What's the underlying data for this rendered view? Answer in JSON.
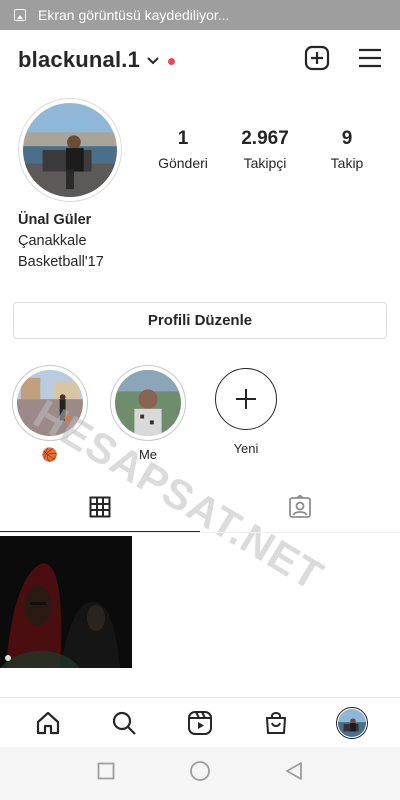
{
  "status_bar": {
    "notification": "Ekran görüntüsü kaydediliyor..."
  },
  "header": {
    "username": "blackunal.1",
    "dropdown_icon": "chevron-down-icon",
    "new_post_icon": "plus-square-icon",
    "menu_icon": "hamburger-menu-icon",
    "live_dot_color": "#ed4956"
  },
  "stats": [
    {
      "value": "1",
      "label": "Gönderi"
    },
    {
      "value": "2.967",
      "label": "Takipçi"
    },
    {
      "value": "9",
      "label": "Takip"
    }
  ],
  "bio": {
    "name": "Ünal Güler",
    "lines": [
      "Çanakkale",
      "Basketball'17"
    ]
  },
  "edit_profile_label": "Profili Düzenle",
  "highlights": [
    {
      "label": "🏀"
    },
    {
      "label": "Me"
    },
    {
      "label": "Yeni"
    }
  ],
  "watermark": "HESAPSAT.NET",
  "tabs": [
    {
      "icon": "grid-icon",
      "active": true
    },
    {
      "icon": "tagged-icon",
      "active": false
    }
  ],
  "bottom_nav": [
    "home-icon",
    "search-icon",
    "reels-icon",
    "shop-icon",
    "profile-avatar"
  ],
  "system_nav": [
    "recents-icon",
    "home-circle-icon",
    "back-icon"
  ]
}
